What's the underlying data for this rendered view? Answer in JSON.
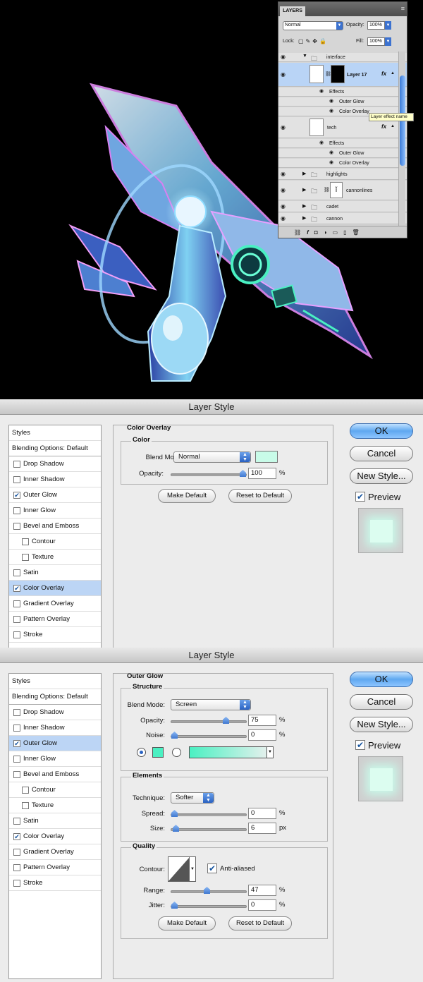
{
  "layers_panel": {
    "tab": "LAYERS",
    "blend_mode": "Normal",
    "opacity_label": "Opacity:",
    "opacity_value": "100%",
    "lock_label": "Lock:",
    "fill_label": "Fill:",
    "fill_value": "100%",
    "tooltip": "Layer effect name",
    "rows": [
      {
        "name": "interface"
      },
      {
        "name": "Layer 17"
      },
      {
        "name": "Effects"
      },
      {
        "name": "Outer Glow"
      },
      {
        "name": "Color Overlay"
      },
      {
        "name": "tech"
      },
      {
        "name": "Effects"
      },
      {
        "name": "Outer Glow"
      },
      {
        "name": "Color Overlay"
      },
      {
        "name": "highlights"
      },
      {
        "name": "cannonlines"
      },
      {
        "name": "cadet"
      },
      {
        "name": "cannon"
      }
    ],
    "fx_label": "fx"
  },
  "dialog1": {
    "title": "Layer Style",
    "styles_header": "Styles",
    "blending": "Blending Options: Default",
    "items": [
      {
        "label": "Drop Shadow",
        "checked": false
      },
      {
        "label": "Inner Shadow",
        "checked": false
      },
      {
        "label": "Outer Glow",
        "checked": true
      },
      {
        "label": "Inner Glow",
        "checked": false
      },
      {
        "label": "Bevel and Emboss",
        "checked": false
      },
      {
        "label": "Contour",
        "checked": false
      },
      {
        "label": "Texture",
        "checked": false
      },
      {
        "label": "Satin",
        "checked": false
      },
      {
        "label": "Color Overlay",
        "checked": true
      },
      {
        "label": "Gradient Overlay",
        "checked": false
      },
      {
        "label": "Pattern Overlay",
        "checked": false
      },
      {
        "label": "Stroke",
        "checked": false
      }
    ],
    "section": "Color Overlay",
    "group": "Color",
    "blend_label": "Blend Mode:",
    "blend_value": "Normal",
    "opacity_label": "Opacity:",
    "opacity_value": "100",
    "opacity_level": 100,
    "pct": "%",
    "make_default": "Make Default",
    "reset_default": "Reset to Default",
    "overlay_color": "#c8fbe8"
  },
  "dialog2": {
    "title": "Layer Style",
    "styles_header": "Styles",
    "blending": "Blending Options: Default",
    "items": [
      {
        "label": "Drop Shadow",
        "checked": false
      },
      {
        "label": "Inner Shadow",
        "checked": false
      },
      {
        "label": "Outer Glow",
        "checked": true
      },
      {
        "label": "Inner Glow",
        "checked": false
      },
      {
        "label": "Bevel and Emboss",
        "checked": false
      },
      {
        "label": "Contour",
        "checked": false
      },
      {
        "label": "Texture",
        "checked": false
      },
      {
        "label": "Satin",
        "checked": false
      },
      {
        "label": "Color Overlay",
        "checked": true
      },
      {
        "label": "Gradient Overlay",
        "checked": false
      },
      {
        "label": "Pattern Overlay",
        "checked": false
      },
      {
        "label": "Stroke",
        "checked": false
      }
    ],
    "section": "Outer Glow",
    "structure": "Structure",
    "blend_label": "Blend Mode:",
    "blend_value": "Screen",
    "opacity_label": "Opacity:",
    "opacity_value": "75",
    "opacity_level": 75,
    "noise_label": "Noise:",
    "noise_value": "0",
    "noise_level": 0,
    "pct": "%",
    "glow_color": "#4af0c2",
    "elements": "Elements",
    "technique_label": "Technique:",
    "technique_value": "Softer",
    "spread_label": "Spread:",
    "spread_value": "0",
    "spread_level": 0,
    "size_label": "Size:",
    "size_value": "6",
    "size_level": 6,
    "px": "px",
    "quality": "Quality",
    "contour_label": "Contour:",
    "anti_aliased": "Anti-aliased",
    "range_label": "Range:",
    "range_value": "47",
    "range_level": 47,
    "jitter_label": "Jitter:",
    "jitter_value": "0",
    "jitter_level": 0,
    "make_default": "Make Default",
    "reset_default": "Reset to Default"
  },
  "buttons": {
    "ok": "OK",
    "cancel": "Cancel",
    "new_style": "New Style...",
    "preview": "Preview"
  }
}
